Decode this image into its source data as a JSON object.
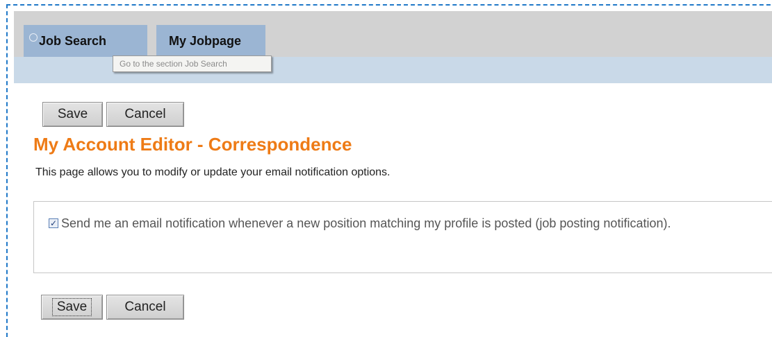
{
  "nav": {
    "tabs": [
      {
        "label": "Job Search",
        "icon": "magnifier-icon"
      },
      {
        "label": "My Jobpage"
      }
    ],
    "tooltip": "Go to the section Job Search"
  },
  "toolbar_top": {
    "save_label": "Save",
    "cancel_label": "Cancel"
  },
  "page": {
    "title": "My Account Editor - Correspondence",
    "description": "This page allows you to modify or update your email notification options."
  },
  "options": [
    {
      "label": "Send me an email notification whenever a new position matching my profile is posted (job posting notification).",
      "checked": true
    }
  ],
  "toolbar_bottom": {
    "save_label": "Save",
    "cancel_label": "Cancel"
  },
  "colors": {
    "title": "#ee7b16",
    "tab": "#9bb5d3",
    "nav_bg": "#d2d2d2",
    "frame": "#1f78c8"
  }
}
